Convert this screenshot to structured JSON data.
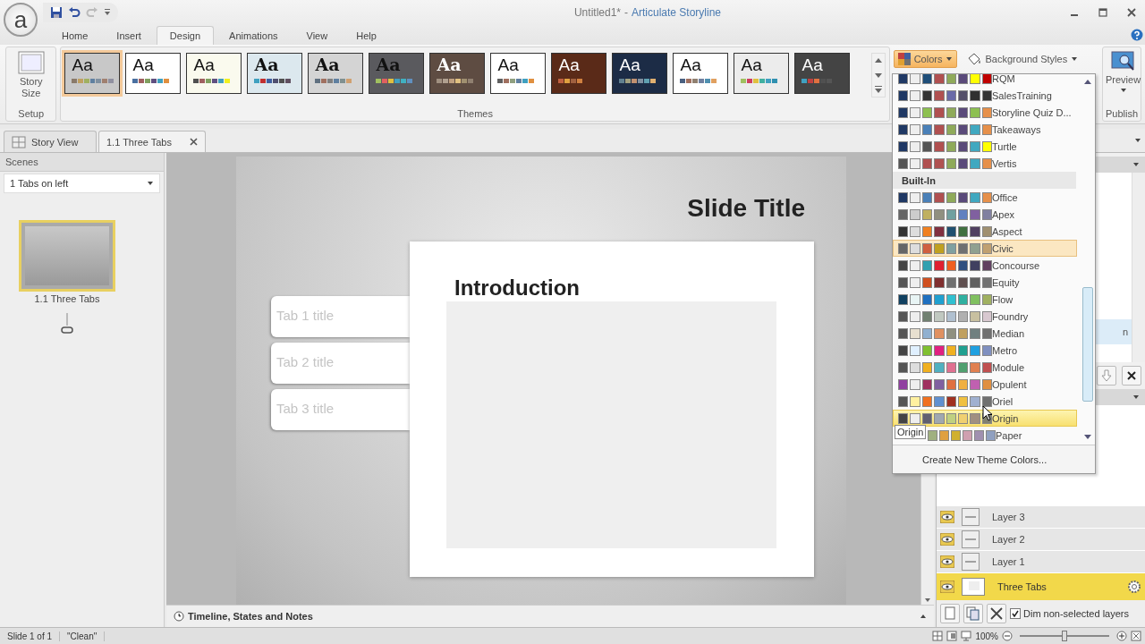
{
  "window": {
    "logo": "a",
    "document_title": "Untitled1*",
    "separator": "-",
    "app_title": "Articulate Storyline"
  },
  "ribbon_tabs": [
    {
      "label": "Home",
      "selected": false
    },
    {
      "label": "Insert",
      "selected": false
    },
    {
      "label": "Design",
      "selected": true
    },
    {
      "label": "Animations",
      "selected": false
    },
    {
      "label": "View",
      "selected": false
    },
    {
      "label": "Help",
      "selected": false
    }
  ],
  "ribbon": {
    "setup": {
      "button": "Story Size",
      "group_label": "Setup"
    },
    "themes": {
      "group_label": "Themes",
      "items": [
        {
          "label": "Aa",
          "kind": "light",
          "color": "#c8c8c8",
          "selected": true,
          "swatches": [
            {
              "color": "#8a7a6a"
            },
            {
              "color": "#c0a060"
            },
            {
              "color": "#a0b060"
            },
            {
              "color": "#6080a0"
            },
            {
              "color": "#8090a0"
            },
            {
              "color": "#a08070"
            },
            {
              "color": "#9090a0"
            }
          ]
        },
        {
          "label": "Aa",
          "kind": "light",
          "color": "#ffffff",
          "selected": false,
          "swatches": [
            {
              "color": "#4a70a0"
            },
            {
              "color": "#a06060"
            },
            {
              "color": "#80a060"
            },
            {
              "color": "#605080"
            },
            {
              "color": "#40a0c0"
            },
            {
              "color": "#e09040"
            }
          ]
        },
        {
          "label": "Aa",
          "kind": "light",
          "color": "#fafaee",
          "selected": false,
          "swatches": [
            {
              "color": "#505050"
            },
            {
              "color": "#a06060"
            },
            {
              "color": "#80a060"
            },
            {
              "color": "#605080"
            },
            {
              "color": "#40a0c0"
            },
            {
              "color": "#f0f020"
            }
          ]
        },
        {
          "label": "Aa",
          "kind": "light-bold",
          "color": "#dce8ee",
          "selected": false,
          "swatches": [
            {
              "color": "#40a0c0"
            },
            {
              "color": "#c03030"
            },
            {
              "color": "#4060a0"
            },
            {
              "color": "#505070"
            },
            {
              "color": "#505050"
            },
            {
              "color": "#605060"
            }
          ]
        },
        {
          "label": "Aa",
          "kind": "light-bold",
          "color": "#d4d4d4",
          "selected": false,
          "swatches": [
            {
              "color": "#607080"
            },
            {
              "color": "#a07060"
            },
            {
              "color": "#808080"
            },
            {
              "color": "#6080a0"
            },
            {
              "color": "#809090"
            },
            {
              "color": "#d0a070"
            }
          ]
        },
        {
          "label": "Aa",
          "kind": "light-bold",
          "color": "#5a5a5e",
          "selected": false,
          "swatches": [
            {
              "color": "#a0c060"
            },
            {
              "color": "#e06060"
            },
            {
              "color": "#e0c040"
            },
            {
              "color": "#40a0c0"
            },
            {
              "color": "#40b0c0"
            },
            {
              "color": "#6090c0"
            }
          ]
        },
        {
          "label": "Aa",
          "kind": "dark-bold",
          "color": "#5e4c42",
          "selected": false,
          "swatches": [
            {
              "color": "#a09080"
            },
            {
              "color": "#b0a090"
            },
            {
              "color": "#c0a080"
            },
            {
              "color": "#e0c080"
            },
            {
              "color": "#a09070"
            },
            {
              "color": "#908070"
            }
          ]
        },
        {
          "label": "Aa",
          "kind": "light",
          "color": "#ffffff",
          "selected": false,
          "swatches": [
            {
              "color": "#606060"
            },
            {
              "color": "#a07060"
            },
            {
              "color": "#90a080"
            },
            {
              "color": "#6080a0"
            },
            {
              "color": "#40a0c0"
            },
            {
              "color": "#e09040"
            }
          ]
        },
        {
          "label": "Aa",
          "kind": "dark",
          "color": "#5a2a18",
          "selected": false,
          "swatches": [
            {
              "color": "#c06040"
            },
            {
              "color": "#e0a040"
            },
            {
              "color": "#a06040"
            },
            {
              "color": "#d08040"
            }
          ]
        },
        {
          "label": "Aa",
          "kind": "dark",
          "color": "#1c2c46",
          "selected": false,
          "swatches": [
            {
              "color": "#608090"
            },
            {
              "color": "#a0a080"
            },
            {
              "color": "#c09070"
            },
            {
              "color": "#8090a0"
            },
            {
              "color": "#60a0b0"
            },
            {
              "color": "#e0b070"
            }
          ]
        },
        {
          "label": "Aa",
          "kind": "light",
          "color": "#ffffff",
          "selected": false,
          "swatches": [
            {
              "color": "#4a6080"
            },
            {
              "color": "#a07060"
            },
            {
              "color": "#908070"
            },
            {
              "color": "#7080a0"
            },
            {
              "color": "#5090b0"
            },
            {
              "color": "#e0a060"
            }
          ]
        },
        {
          "label": "Aa",
          "kind": "light",
          "color": "#ececec",
          "selected": false,
          "swatches": [
            {
              "color": "#a0c060"
            },
            {
              "color": "#d04060"
            },
            {
              "color": "#e0c040"
            },
            {
              "color": "#40b0a0"
            },
            {
              "color": "#40a0c0"
            },
            {
              "color": "#3090b0"
            }
          ]
        },
        {
          "label": "Aa",
          "kind": "dark",
          "color": "#444444",
          "selected": false,
          "swatches": [
            {
              "color": "#40a0c0"
            },
            {
              "color": "#c04040"
            },
            {
              "color": "#e07040"
            },
            {
              "color": "#505050"
            },
            {
              "color": "#555555"
            }
          ]
        }
      ]
    },
    "colors_button": {
      "label": "Colors",
      "active": true
    },
    "background_styles_button": {
      "label": "Background Styles"
    },
    "publish": {
      "button": "Preview",
      "group_label": "Publish"
    }
  },
  "document_tabs": [
    {
      "label": "Story View",
      "kind": "story",
      "selected": false
    },
    {
      "label": "1.1 Three Tabs",
      "kind": "slide",
      "selected": true
    }
  ],
  "scenes_panel": {
    "title": "Scenes",
    "scene_select": "1 Tabs on left",
    "slides": [
      {
        "label": "1.1 Three Tabs",
        "selected": true
      }
    ]
  },
  "slide": {
    "title": "Slide Title",
    "heading": "Introduction",
    "tabs": [
      "Tab 1 title",
      "Tab 2 title",
      "Tab 3 title"
    ]
  },
  "timeline_bar": {
    "label": "Timeline, States and Notes"
  },
  "states_panel": {
    "state_label": "n"
  },
  "layers_panel": {
    "layers": [
      {
        "name": "Layer 3",
        "kind": "layer",
        "selected": false
      },
      {
        "name": "Layer 2",
        "kind": "layer",
        "selected": false
      },
      {
        "name": "Layer 1",
        "kind": "layer",
        "selected": false
      },
      {
        "name": "Three Tabs",
        "kind": "base",
        "selected": true
      }
    ],
    "dim_option": {
      "label": "Dim non-selected layers",
      "checked": true
    }
  },
  "colors_menu": {
    "custom_schemes": [
      {
        "name": "RQM",
        "selected": false,
        "current": false,
        "swatches": [
          {
            "color": "#1f3864"
          },
          {
            "color": "#eeeeee"
          },
          {
            "color": "#1f4e79"
          },
          {
            "color": "#b05050"
          },
          {
            "color": "#8faa5a"
          },
          {
            "color": "#5a4a7a"
          },
          {
            "color": "#ffff00"
          },
          {
            "color": "#c00000"
          }
        ]
      },
      {
        "name": "SalesTraining",
        "selected": false,
        "current": false,
        "swatches": [
          {
            "color": "#1f3864"
          },
          {
            "color": "#eeeeee"
          },
          {
            "color": "#333333"
          },
          {
            "color": "#b05050"
          },
          {
            "color": "#6a6aa8"
          },
          {
            "color": "#55506a"
          },
          {
            "color": "#303030"
          },
          {
            "color": "#353535"
          }
        ]
      },
      {
        "name": "Storyline Quiz D...",
        "selected": false,
        "current": false,
        "swatches": [
          {
            "color": "#1f3864"
          },
          {
            "color": "#eeeeee"
          },
          {
            "color": "#8dc050"
          },
          {
            "color": "#b05050"
          },
          {
            "color": "#8faa5a"
          },
          {
            "color": "#5a4a7a"
          },
          {
            "color": "#8dc052"
          },
          {
            "color": "#e6904a"
          }
        ]
      },
      {
        "name": "Takeaways",
        "selected": false,
        "current": false,
        "swatches": [
          {
            "color": "#1f3864"
          },
          {
            "color": "#eeeeee"
          },
          {
            "color": "#4a80b8"
          },
          {
            "color": "#b05050"
          },
          {
            "color": "#8faa5a"
          },
          {
            "color": "#5a4a7a"
          },
          {
            "color": "#40a8c0"
          },
          {
            "color": "#e6904a"
          }
        ]
      },
      {
        "name": "Turtle",
        "selected": false,
        "current": false,
        "swatches": [
          {
            "color": "#1f3864"
          },
          {
            "color": "#eeeeee"
          },
          {
            "color": "#555555"
          },
          {
            "color": "#b05050"
          },
          {
            "color": "#8faa5a"
          },
          {
            "color": "#5a4a7a"
          },
          {
            "color": "#40a8c0"
          },
          {
            "color": "#ffff00"
          }
        ]
      },
      {
        "name": "Vertis",
        "selected": false,
        "current": false,
        "swatches": [
          {
            "color": "#555555"
          },
          {
            "color": "#eeeeee"
          },
          {
            "color": "#b05050"
          },
          {
            "color": "#b05252"
          },
          {
            "color": "#8faa5a"
          },
          {
            "color": "#5a4a7a"
          },
          {
            "color": "#40a8c0"
          },
          {
            "color": "#e6904a"
          }
        ]
      }
    ],
    "builtin_title": "Built-In",
    "builtin_schemes": [
      {
        "name": "Office",
        "selected": false,
        "current": false,
        "swatches": [
          {
            "color": "#1f3864"
          },
          {
            "color": "#eeeeee"
          },
          {
            "color": "#4a80b8"
          },
          {
            "color": "#b05050"
          },
          {
            "color": "#8faa5a"
          },
          {
            "color": "#5a4a7a"
          },
          {
            "color": "#40a8c0"
          },
          {
            "color": "#e6904a"
          }
        ]
      },
      {
        "name": "Apex",
        "selected": false,
        "current": false,
        "swatches": [
          {
            "color": "#666666"
          },
          {
            "color": "#cccccc"
          },
          {
            "color": "#c0b060"
          },
          {
            "color": "#909080"
          },
          {
            "color": "#70a0a0"
          },
          {
            "color": "#6080c0"
          },
          {
            "color": "#8060a0"
          },
          {
            "color": "#8080a0"
          }
        ]
      },
      {
        "name": "Aspect",
        "selected": false,
        "current": false,
        "swatches": [
          {
            "color": "#333333"
          },
          {
            "color": "#dddddd"
          },
          {
            "color": "#f08020"
          },
          {
            "color": "#803040"
          },
          {
            "color": "#205070"
          },
          {
            "color": "#407040"
          },
          {
            "color": "#504060"
          },
          {
            "color": "#a09070"
          }
        ]
      },
      {
        "name": "Civic",
        "selected": false,
        "current": true,
        "swatches": [
          {
            "color": "#666666"
          },
          {
            "color": "#dddddd"
          },
          {
            "color": "#d06040"
          },
          {
            "color": "#c0a020"
          },
          {
            "color": "#80a0a0"
          },
          {
            "color": "#707070"
          },
          {
            "color": "#90a090"
          },
          {
            "color": "#c0a070"
          }
        ]
      },
      {
        "name": "Concourse",
        "selected": false,
        "current": false,
        "swatches": [
          {
            "color": "#444444"
          },
          {
            "color": "#eeeeee"
          },
          {
            "color": "#30a0b0"
          },
          {
            "color": "#e02030"
          },
          {
            "color": "#f06020"
          },
          {
            "color": "#305080"
          },
          {
            "color": "#404060"
          },
          {
            "color": "#604060"
          }
        ]
      },
      {
        "name": "Equity",
        "selected": false,
        "current": false,
        "swatches": [
          {
            "color": "#555555"
          },
          {
            "color": "#eeeeee"
          },
          {
            "color": "#d05020"
          },
          {
            "color": "#803030"
          },
          {
            "color": "#707070"
          },
          {
            "color": "#605050"
          },
          {
            "color": "#606060"
          },
          {
            "color": "#727272"
          }
        ]
      },
      {
        "name": "Flow",
        "selected": false,
        "current": false,
        "swatches": [
          {
            "color": "#104060"
          },
          {
            "color": "#e8f4f4"
          },
          {
            "color": "#2070c0"
          },
          {
            "color": "#20a0d0"
          },
          {
            "color": "#30c0d0"
          },
          {
            "color": "#30b0a0"
          },
          {
            "color": "#80c060"
          },
          {
            "color": "#a0b060"
          }
        ]
      },
      {
        "name": "Foundry",
        "selected": false,
        "current": false,
        "swatches": [
          {
            "color": "#555555"
          },
          {
            "color": "#eeeeee"
          },
          {
            "color": "#708070"
          },
          {
            "color": "#c0c8c0"
          },
          {
            "color": "#b0c0d0"
          },
          {
            "color": "#b0b0b0"
          },
          {
            "color": "#c8c0a0"
          },
          {
            "color": "#d8c8d0"
          }
        ]
      },
      {
        "name": "Median",
        "selected": false,
        "current": false,
        "swatches": [
          {
            "color": "#555555"
          },
          {
            "color": "#e8e0d0"
          },
          {
            "color": "#90b0d0"
          },
          {
            "color": "#e09060"
          },
          {
            "color": "#909080"
          },
          {
            "color": "#c0a060"
          },
          {
            "color": "#708080"
          },
          {
            "color": "#707070"
          }
        ]
      },
      {
        "name": "Metro",
        "selected": false,
        "current": false,
        "swatches": [
          {
            "color": "#444444"
          },
          {
            "color": "#e0f0ff"
          },
          {
            "color": "#80c030"
          },
          {
            "color": "#e02080"
          },
          {
            "color": "#f0b020"
          },
          {
            "color": "#20a090"
          },
          {
            "color": "#20a0e0"
          },
          {
            "color": "#8090c0"
          }
        ]
      },
      {
        "name": "Module",
        "selected": false,
        "current": false,
        "swatches": [
          {
            "color": "#555555"
          },
          {
            "color": "#dddddd"
          },
          {
            "color": "#f0b020"
          },
          {
            "color": "#50b0c0"
          },
          {
            "color": "#e07090"
          },
          {
            "color": "#50a070"
          },
          {
            "color": "#e08050"
          },
          {
            "color": "#c05050"
          }
        ]
      },
      {
        "name": "Opulent",
        "selected": false,
        "current": false,
        "swatches": [
          {
            "color": "#9040a0"
          },
          {
            "color": "#eeeeee"
          },
          {
            "color": "#a03060"
          },
          {
            "color": "#8060a0"
          },
          {
            "color": "#e07040"
          },
          {
            "color": "#f0b040"
          },
          {
            "color": "#c060b0"
          },
          {
            "color": "#e09040"
          }
        ]
      },
      {
        "name": "Oriel",
        "selected": false,
        "current": false,
        "swatches": [
          {
            "color": "#555555"
          },
          {
            "color": "#fff0a0"
          },
          {
            "color": "#f07020"
          },
          {
            "color": "#6090d0"
          },
          {
            "color": "#a03020"
          },
          {
            "color": "#f0c040"
          },
          {
            "color": "#a0b0d0"
          },
          {
            "color": "#707070"
          }
        ]
      },
      {
        "name": "Origin",
        "selected": true,
        "current": false,
        "swatches": [
          {
            "color": "#444444"
          },
          {
            "color": "#eeeeee"
          },
          {
            "color": "#606070"
          },
          {
            "color": "#a0a8b0"
          },
          {
            "color": "#c0d080"
          },
          {
            "color": "#f0d070"
          },
          {
            "color": "#a09080"
          },
          {
            "color": "#808070"
          }
        ]
      },
      {
        "name": "Paper",
        "selected": false,
        "current": false,
        "swatches": [
          {
            "color": "#a0b080"
          },
          {
            "color": "#e0a040"
          },
          {
            "color": "#d0b030"
          },
          {
            "color": "#d0a0b0"
          },
          {
            "color": "#a090b0"
          },
          {
            "color": "#90a0c0"
          }
        ]
      }
    ],
    "create_command": "Create New Theme Colors...",
    "tooltip": "Origin"
  },
  "status_bar": {
    "slide_count": "Slide 1 of 1",
    "theme": "\"Clean\"",
    "zoom": "100%",
    "zoom_slider": {
      "level": 0.5
    }
  }
}
